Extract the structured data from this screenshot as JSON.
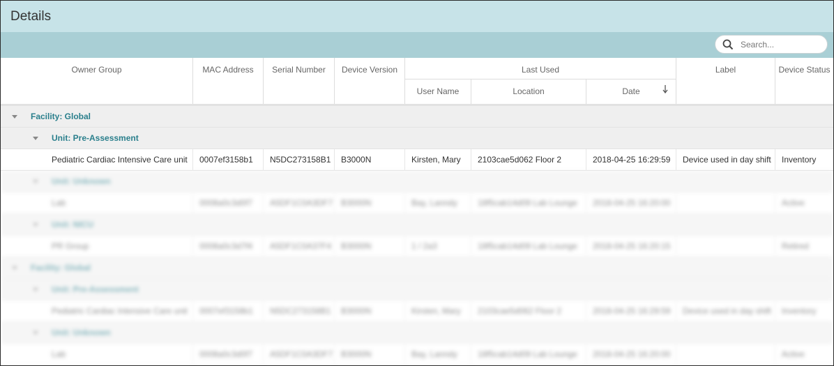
{
  "panel": {
    "title": "Details"
  },
  "search": {
    "placeholder": "Search..."
  },
  "columns": {
    "owner_group": "Owner Group",
    "mac_address": "MAC Address",
    "serial_number": "Serial Number",
    "device_version": "Device Version",
    "last_used": "Last Used",
    "user_name": "User Name",
    "location": "Location",
    "date": "Date",
    "label": "Label",
    "device_status": "Device Status"
  },
  "rows": {
    "facility": "Facility: Global",
    "unit": "Unit: Pre-Assessment",
    "record": {
      "owner_group": "Pediatric Cardiac Intensive Care unit",
      "mac": "0007ef3158b1",
      "serial": "N5DC273158B1",
      "version": "B3000N",
      "user": "Kirsten, Mary",
      "location": "2103cae5d062 Floor 2",
      "date": "2018-04-25 16:29:59",
      "label": "Device used in day shift",
      "status": "Inventory"
    }
  },
  "blurred": {
    "unit_a": "Unit: Unknown",
    "row_a": [
      "Lab",
      "0008a0c3d0f7",
      "A5DF1C0A3DF7",
      "B3000N",
      "Bay, Lanndy",
      "18f5cab14d09 Lab Lounge",
      "2018-04-25 16:20:00",
      "",
      "Active"
    ],
    "unit_b": "Unit: NICU",
    "row_b": [
      "PR Group",
      "0008a0c3d7f4",
      "A5DF1C0A37F4",
      "B3000N",
      "1 / 2a3",
      "18f5cab14d09 Lab Lounge",
      "2018-04-25 16:20:15",
      "",
      "Retired"
    ],
    "facility2": "Facility: Global",
    "unit_c": "Unit: Pre-Assessment",
    "row_c": [
      "Pediatric Cardiac Intensive Care unit",
      "0007ef3158b1",
      "N5DC273158B1",
      "B3000N",
      "Kirsten, Mary",
      "2103cae5d062 Floor 2",
      "2018-04-25 16:29:59",
      "Device used in day shift",
      "Inventory"
    ],
    "unit_d": "Unit: Unknown",
    "row_d": [
      "Lab",
      "0008a0c3d0f7",
      "A5DF1C0A3DF7",
      "B3000N",
      "Bay, Lanndy",
      "18f5cab14d09 Lab Lounge",
      "2018-04-25 16:20:00",
      "",
      "Active"
    ]
  },
  "icons": {
    "search": "search-icon",
    "sort": "arrow-down-icon",
    "expand": "caret-down-icon"
  },
  "colors": {
    "title_bar": "#c7e3e8",
    "toolbar": "#a9cfd5",
    "group_text": "#2a7f8c",
    "group_row": "#efefef"
  }
}
